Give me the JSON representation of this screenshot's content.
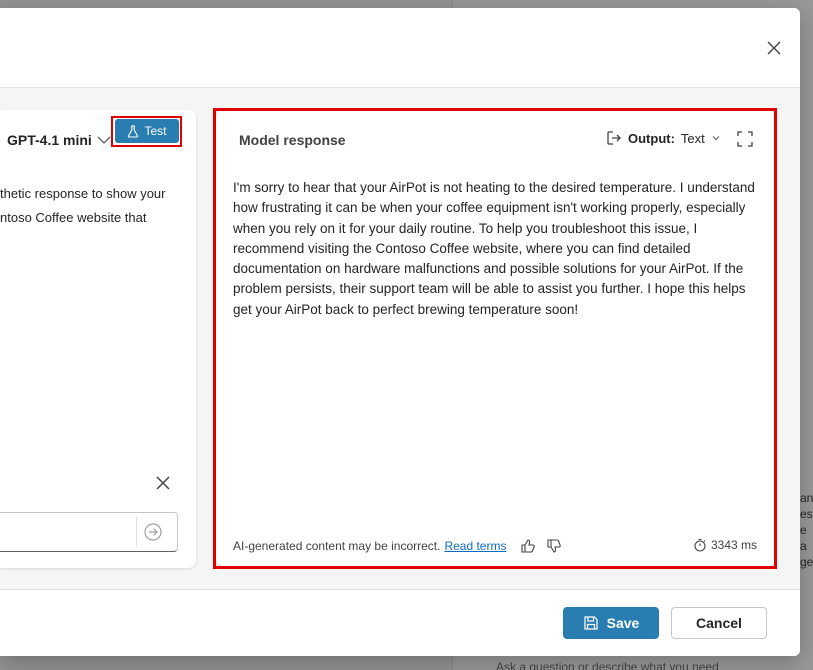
{
  "background": {
    "snippet_lines": [
      "an",
      "est",
      "e a",
      "ge"
    ],
    "bottom_prompt": "Ask a question or describe what you need"
  },
  "left_panel": {
    "model_name": "GPT-4.1 mini",
    "test_label": "Test",
    "text_lines": [
      "thetic response to show your",
      "ntoso Coffee website that"
    ]
  },
  "response": {
    "title": "Model response",
    "output_label": "Output:",
    "output_value": "Text",
    "body": "I'm sorry to hear that your AirPot is not heating to the desired temperature. I understand how frustrating it can be when your coffee equipment isn't working properly, especially when you rely on it for your daily routine. To help you troubleshoot this issue, I recommend visiting the Contoso Coffee website, where you can find detailed documentation on hardware malfunctions and possible solutions for your AirPot. If the problem persists, their support team will be able to assist you further. I hope this helps get your AirPot back to perfect brewing temperature soon!",
    "disclaimer": "AI-generated content may be incorrect.",
    "read_terms": "Read terms",
    "latency": "3343 ms"
  },
  "footer": {
    "save_label": "Save",
    "cancel_label": "Cancel"
  },
  "colors": {
    "primary": "#2a7db0",
    "highlight": "#e00000",
    "link": "#0f6cbd"
  }
}
